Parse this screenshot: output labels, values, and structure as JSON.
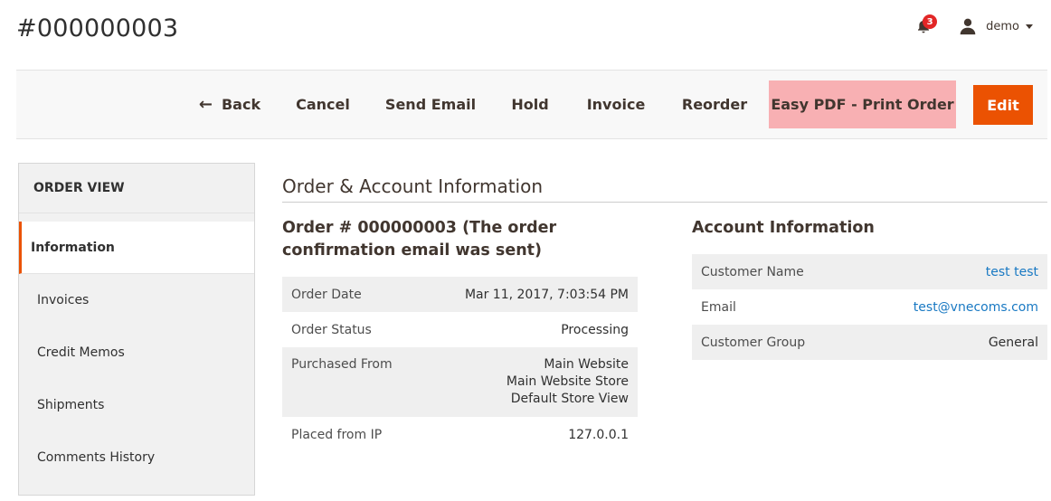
{
  "header": {
    "title": "#000000003",
    "notification_count": "3",
    "user_name": "demo"
  },
  "toolbar": {
    "back_label": "Back",
    "cancel_label": "Cancel",
    "send_email_label": "Send Email",
    "hold_label": "Hold",
    "invoice_label": "Invoice",
    "reorder_label": "Reorder",
    "easy_pdf_label": "Easy PDF - Print Order",
    "edit_label": "Edit"
  },
  "sidebar": {
    "title": "ORDER VIEW",
    "items": [
      {
        "label": "Information"
      },
      {
        "label": "Invoices"
      },
      {
        "label": "Credit Memos"
      },
      {
        "label": "Shipments"
      },
      {
        "label": "Comments History"
      }
    ]
  },
  "main": {
    "section_title": "Order & Account Information",
    "order": {
      "title": "Order # 000000003 (The order confirmation email was sent)",
      "rows": [
        {
          "label": "Order Date",
          "value": "Mar 11, 2017, 7:03:54 PM"
        },
        {
          "label": "Order Status",
          "value": "Processing"
        },
        {
          "label": "Purchased From",
          "value_lines": [
            "Main Website",
            "Main Website Store",
            "Default Store View"
          ]
        },
        {
          "label": "Placed from IP",
          "value": "127.0.0.1"
        }
      ]
    },
    "account": {
      "title": "Account Information",
      "rows": [
        {
          "label": "Customer Name",
          "value": "test test"
        },
        {
          "label": "Email",
          "value": "test@vnecoms.com"
        },
        {
          "label": "Customer Group",
          "value": "General"
        }
      ]
    }
  },
  "colors": {
    "accent": "#eb5202",
    "pdf_button_bg": "#f8b0b3",
    "link": "#1979c3",
    "badge": "#e22626"
  }
}
